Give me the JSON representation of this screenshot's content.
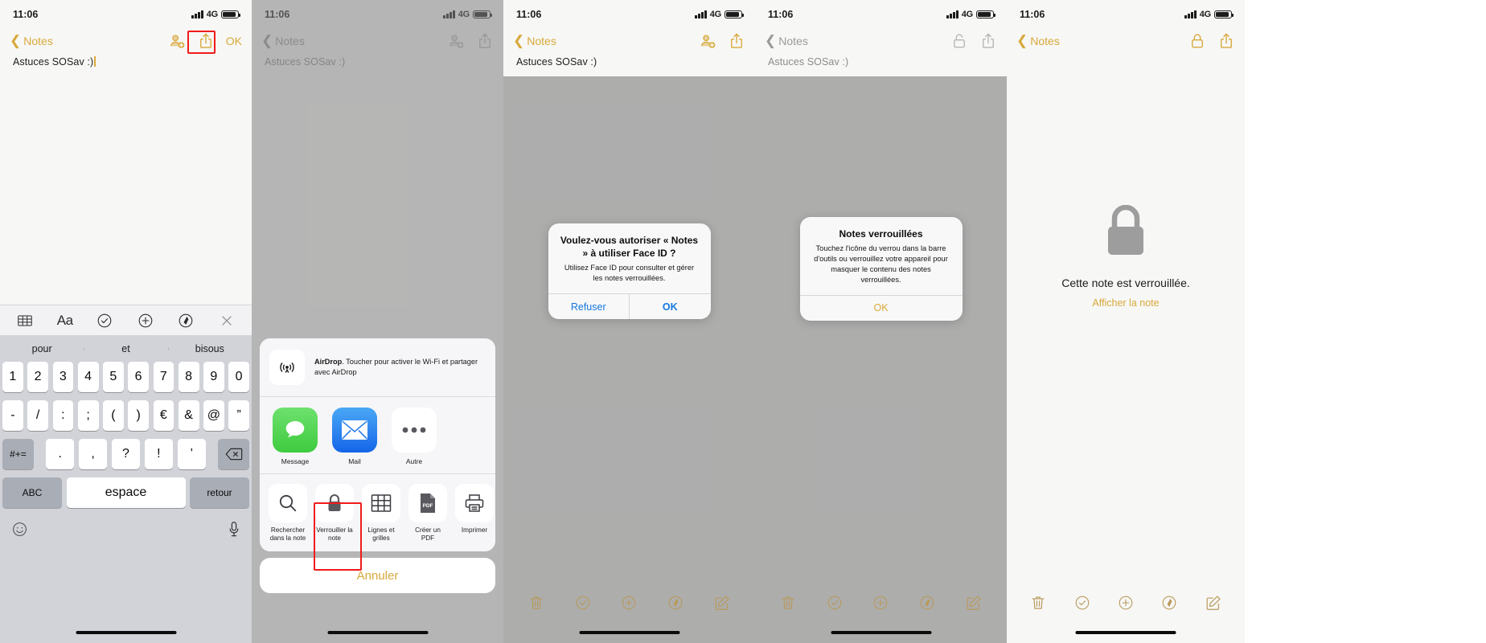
{
  "status": {
    "time": "11:06",
    "network": "4G"
  },
  "nav": {
    "back_label": "Notes",
    "ok_label": "OK"
  },
  "note": {
    "title": "Astuces SOSav :)"
  },
  "icons": {
    "back_chevron": "chevron-left-icon",
    "collaborate": "add-person-icon",
    "share": "share-icon",
    "lock_closed": "lock-closed-icon",
    "lock_open": "lock-open-icon",
    "table": "table-icon",
    "format": "format-aa-icon",
    "checklist": "checklist-icon",
    "add": "plus-circle-icon",
    "markup": "markup-pen-icon",
    "close": "close-x-icon",
    "trash": "trash-icon",
    "compose": "compose-icon",
    "emoji": "emoji-icon",
    "mic": "microphone-icon",
    "delete_key": "backspace-icon",
    "search": "search-icon",
    "pdf": "pdf-icon",
    "print": "printer-icon",
    "airdrop": "airdrop-icon"
  },
  "keyboard": {
    "predictions": [
      "pour",
      "et",
      "bisous"
    ],
    "row1": [
      "1",
      "2",
      "3",
      "4",
      "5",
      "6",
      "7",
      "8",
      "9",
      "0"
    ],
    "row2": [
      "-",
      "/",
      ":",
      ";",
      "(",
      ")",
      "€",
      "&",
      "@",
      "”"
    ],
    "row3_symbol": "#+=",
    "row3": [
      ".",
      ",",
      "?",
      "!",
      "’"
    ],
    "row4": {
      "abc": "ABC",
      "space": "espace",
      "return": "retour"
    }
  },
  "share_sheet": {
    "airdrop": {
      "bold": "AirDrop",
      "text": ". Toucher pour activer le Wi-Fi et partager avec AirDrop"
    },
    "apps": [
      {
        "label": "Message",
        "icon": "messages-app-icon",
        "color": "#5fd35f"
      },
      {
        "label": "Mail",
        "icon": "mail-app-icon",
        "color": "#2a7ded"
      },
      {
        "label": "Autre",
        "icon": "more-dots-icon",
        "color": "#ffffff"
      }
    ],
    "actions": [
      {
        "label": "Rechercher dans la note",
        "icon": "search-icon"
      },
      {
        "label": "Verrouiller la note",
        "icon": "lock-closed-icon",
        "highlighted": true
      },
      {
        "label": "Lignes et grilles",
        "icon": "table-icon"
      },
      {
        "label": "Créer un PDF",
        "icon": "pdf-icon"
      },
      {
        "label": "Imprimer",
        "icon": "printer-icon"
      }
    ],
    "cancel_label": "Annuler"
  },
  "faceid_alert": {
    "title": "Voulez-vous autoriser « Notes » à utiliser Face ID ?",
    "message": "Utilisez Face ID pour consulter et gérer les notes verrouillées.",
    "buttons": [
      {
        "label": "Refuser",
        "style": "blue"
      },
      {
        "label": "OK",
        "style": "blue-strong"
      }
    ]
  },
  "locked_alert": {
    "title": "Notes verrouillées",
    "message": "Touchez l'icône du verrou dans la barre d'outils ou verrouillez votre appareil pour masquer le contenu des notes verrouillées.",
    "buttons": [
      {
        "label": "OK",
        "style": "gold"
      }
    ]
  },
  "locked_note": {
    "message": "Cette note est verrouillée.",
    "link": "Afficher la note"
  },
  "colors": {
    "accent_gold": "#d8a93b",
    "alert_blue": "#1577e0",
    "highlight_red": "#f01b1b",
    "paper": "#f7f7f5"
  }
}
